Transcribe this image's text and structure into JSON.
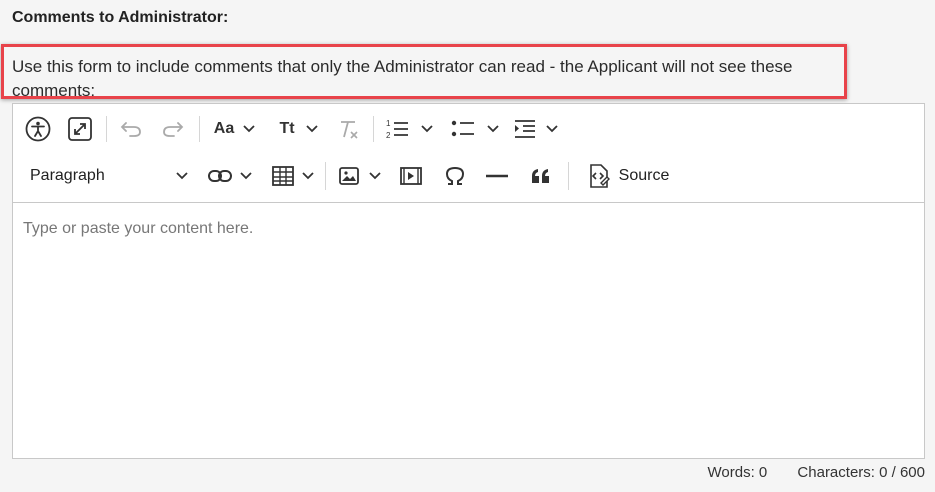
{
  "heading": "Comments to Administrator:",
  "instructions": "Use this form to include comments that only the Administrator can read - the Applicant will not see these comments:",
  "toolbar": {
    "font_family_label": "Aa",
    "font_size_label": "Tt",
    "heading_select_value": "Paragraph",
    "source_label": "Source"
  },
  "editor": {
    "placeholder": "Type or paste your content here."
  },
  "footer": {
    "words": "Words: 0",
    "characters": "Characters: 0 / 600"
  },
  "colors": {
    "highlight_border": "#e8434a",
    "background": "#f5f5f5"
  },
  "icons": [
    "accessibility-icon",
    "fullscreen-icon",
    "undo-icon",
    "redo-icon",
    "font-family-icon",
    "font-size-icon",
    "remove-format-icon",
    "numbered-list-icon",
    "bulleted-list-icon",
    "indent-icon",
    "link-icon",
    "table-icon",
    "image-icon",
    "media-icon",
    "special-characters-icon",
    "horizontal-line-icon",
    "blockquote-icon",
    "source-icon",
    "chevron-down-icon"
  ]
}
